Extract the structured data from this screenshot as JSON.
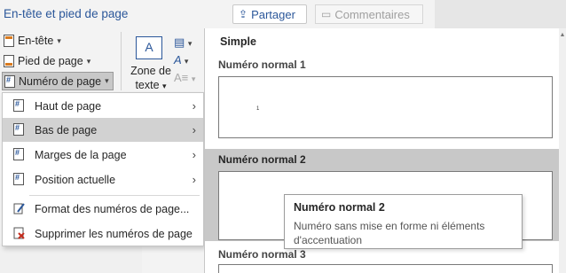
{
  "title_bar": {
    "title": "En-tête et pied de page",
    "share_label": "Partager",
    "comments_label": "Commentaires"
  },
  "ribbon": {
    "header": "En-tête",
    "footer": "Pied de page",
    "page_number": "Numéro de page",
    "textbox_line1": "Zone de",
    "textbox_line2": "texte",
    "textbox_glyph": "A"
  },
  "menu": {
    "items": [
      {
        "label": "Haut de page",
        "icon": "page-top-icon",
        "submenu": true
      },
      {
        "label": "Bas de page",
        "icon": "page-bottom-icon",
        "submenu": true
      },
      {
        "label": "Marges de la page",
        "icon": "page-margins-icon",
        "submenu": true
      },
      {
        "label": "Position actuelle",
        "icon": "current-position-icon",
        "submenu": true
      },
      {
        "label": "Format des numéros de page...",
        "icon": "format-numbers-icon",
        "submenu": false
      },
      {
        "label": "Supprimer les numéros de page",
        "icon": "remove-numbers-icon",
        "submenu": false
      }
    ],
    "active_index": 1
  },
  "gallery": {
    "section": "Simple",
    "items": [
      {
        "label": "Numéro normal 1",
        "preview_number": "1"
      },
      {
        "label": "Numéro normal 2"
      },
      {
        "label": "Numéro normal 3"
      }
    ],
    "hovered_index": 1
  },
  "tooltip": {
    "title": "Numéro normal 2",
    "description": "Numéro sans mise en forme ni éléments d'accentuation"
  }
}
